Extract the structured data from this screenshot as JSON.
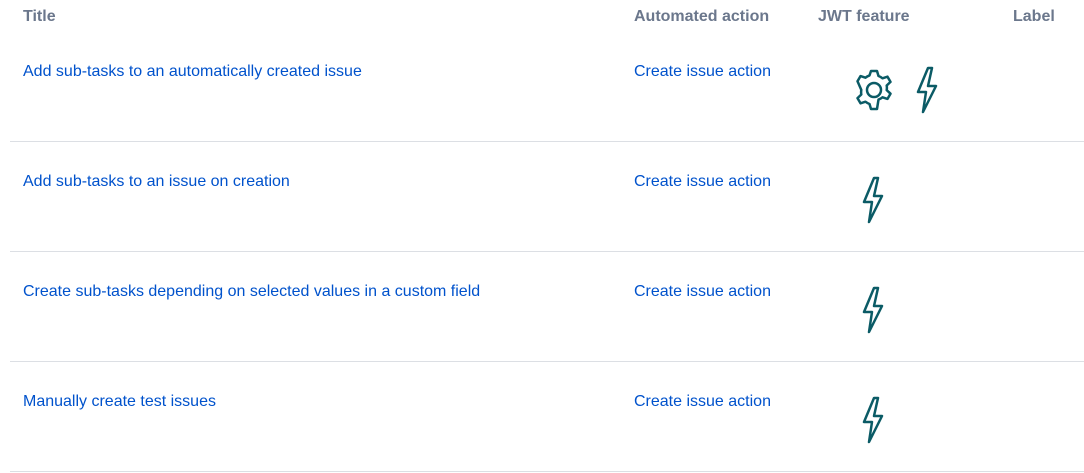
{
  "table": {
    "headers": {
      "title": "Title",
      "action": "Automated action",
      "jwt": "JWT feature",
      "label": "Label"
    },
    "rows": [
      {
        "title": "Add sub-tasks to an automatically created issue",
        "action": "Create issue action",
        "icons": [
          "gear-icon",
          "lightning-icon"
        ]
      },
      {
        "title": "Add sub-tasks to an issue on creation",
        "action": "Create issue action",
        "icons": [
          "lightning-icon"
        ]
      },
      {
        "title": "Create sub-tasks depending on selected values in a custom field",
        "action": "Create issue action",
        "icons": [
          "lightning-icon"
        ]
      },
      {
        "title": "Manually create test issues",
        "action": "Create issue action",
        "icons": [
          "lightning-icon"
        ]
      }
    ]
  },
  "colors": {
    "link": "#0052cc",
    "header_text": "#6b778c",
    "icon_stroke": "#0b5b66",
    "row_divider": "#dcdfe4"
  }
}
